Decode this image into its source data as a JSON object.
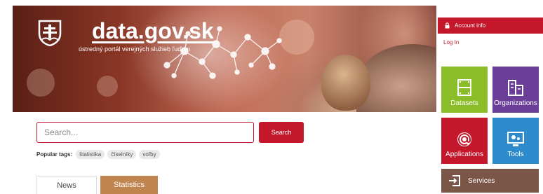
{
  "header": {
    "site_name": "data.gov.sk",
    "tagline": "ústredný portál verejných služieb ľuďom"
  },
  "account": {
    "title": "Account info",
    "login": "Log In"
  },
  "tiles": {
    "datasets": "Datasets",
    "organizations": "Organizations",
    "applications": "Applications",
    "tools": "Tools",
    "services": "Services"
  },
  "search": {
    "placeholder": "Search...",
    "button": "Search",
    "popular_label": "Popular tags:",
    "tags": [
      "štatistika",
      "číselníky",
      "voľby"
    ]
  },
  "tabs": {
    "news": "News",
    "statistics": "Statistics"
  },
  "colors": {
    "brand_red": "#c4172c",
    "datasets_green": "#8bbd2a",
    "organizations_purple": "#6b3f98",
    "tools_blue": "#2e8bcb",
    "services_brown": "#7a5648",
    "statistics_tan": "#c0844f"
  }
}
